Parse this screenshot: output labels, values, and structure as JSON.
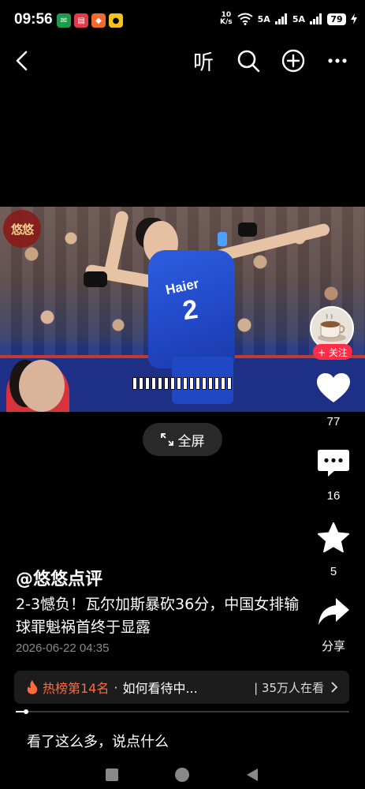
{
  "status_bar": {
    "time": "09:56",
    "net_speed_value": "10",
    "net_speed_unit": "K/s",
    "signal1": "5A",
    "signal2": "5A",
    "battery": "79",
    "icons": [
      "wifi-icon",
      "signal-icon",
      "charging-icon"
    ]
  },
  "top_nav": {
    "back_icon": "back-arrow-icon",
    "listen_label": "听",
    "search_icon": "search-icon",
    "add_icon": "plus-circle-icon",
    "more_icon": "more-icon"
  },
  "video": {
    "watermark": "悠悠",
    "jersey_brand": "Haier",
    "jersey_number": "2",
    "fullscreen_label": "全屏"
  },
  "actions": {
    "follow_label": "+ 关注",
    "like_count": "77",
    "comment_count": "16",
    "favorite_count": "5",
    "share_label": "分享"
  },
  "post": {
    "author": "@悠悠点评",
    "title": "2-3憾负！瓦尔加斯暴砍36分，中国女排输球罪魁祸首终于显露",
    "date": "2026-06-22 04:35"
  },
  "hot_banner": {
    "rank_label": "热榜第14名",
    "separator": "·",
    "topic": "如何看待中...",
    "viewers": "| 35万人在看"
  },
  "progress": {
    "fraction": 0.03
  },
  "comment": {
    "placeholder": "看了这么多，说点什么"
  },
  "colors": {
    "accent_red": "#ff2d45",
    "hot_orange": "#ff6a3d",
    "jersey_blue": "#2147c6"
  }
}
